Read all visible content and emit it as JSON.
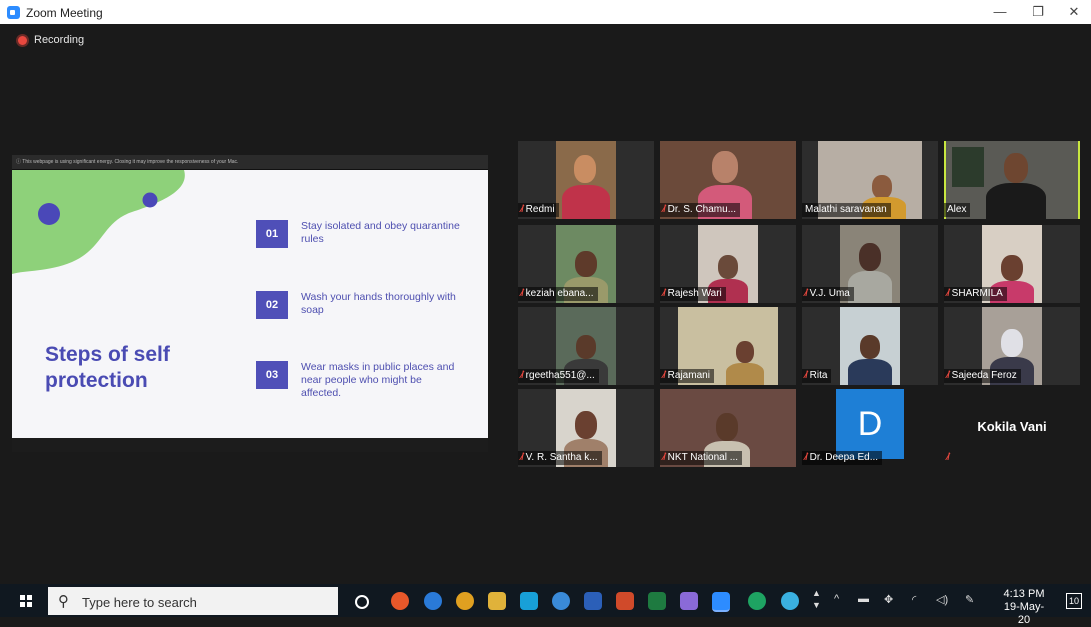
{
  "window": {
    "title": "Zoom Meeting",
    "minimize": "—",
    "restore": "❐",
    "close": "✕"
  },
  "recording": {
    "label": "Recording"
  },
  "share": {
    "banner": "ⓘ  This webpage is using significant energy. Closing it may improve the responsiveness of your Mac.",
    "slide_title": "Steps of self protection",
    "steps": [
      {
        "num": "01",
        "text": "Stay isolated and obey quarantine rules"
      },
      {
        "num": "02",
        "text": "Wash your hands thoroughly with soap"
      },
      {
        "num": "03",
        "text": "Wear masks in public places and near people who might be affected."
      }
    ],
    "colors": {
      "accent": "#4f4fb8",
      "blob": "#8ed17a",
      "dot": "#4a48b8"
    }
  },
  "participants": [
    {
      "name": "Redmi",
      "muted": true
    },
    {
      "name": "Dr. S. Chamu...",
      "muted": true
    },
    {
      "name": "Malathi saravanan",
      "muted": false
    },
    {
      "name": "Alex",
      "muted": false,
      "active": true
    },
    {
      "name": "keziah ebana...",
      "muted": true
    },
    {
      "name": "Rajesh Wari",
      "muted": true
    },
    {
      "name": "V.J. Uma",
      "muted": true
    },
    {
      "name": "SHARMILA",
      "muted": true
    },
    {
      "name": "rgeetha551@...",
      "muted": true
    },
    {
      "name": "Rajamani",
      "muted": true
    },
    {
      "name": "Rita",
      "muted": true
    },
    {
      "name": "Sajeeda Feroz",
      "muted": true
    },
    {
      "name": "V. R. Santha k...",
      "muted": true
    },
    {
      "name": "NKT National ...",
      "muted": true
    },
    {
      "name": "Dr. Deepa Ed...",
      "muted": true,
      "avatar_letter": "D"
    },
    {
      "name": "",
      "muted": true,
      "display_name": "Kokila Vani"
    }
  ],
  "taskbar": {
    "search_placeholder": "Type here to search",
    "clock_time": "4:13 PM",
    "clock_date": "19-May-20",
    "notifications": "10"
  }
}
